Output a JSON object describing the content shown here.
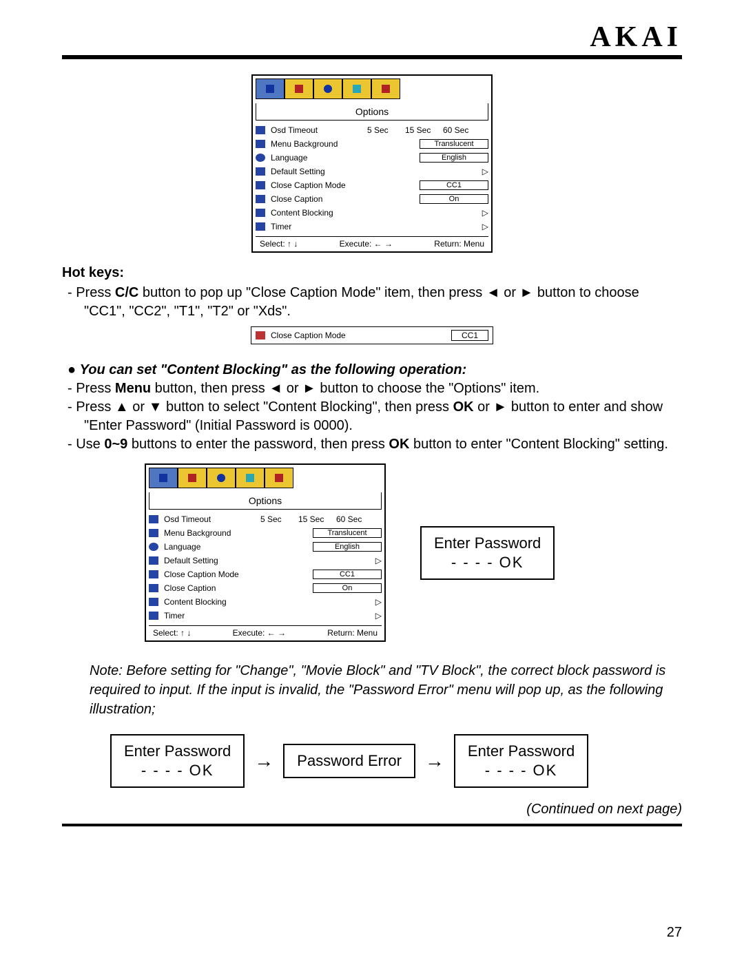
{
  "brand": "AKAI",
  "page_number": "27",
  "continued": "(Continued on next page)",
  "hotkeys_title": "Hot keys:",
  "hk_bullet_1_a": "Press ",
  "hk_bullet_1_b": "C/C",
  "hk_bullet_1_c": " button to pop up \"Close Caption Mode\" item, then press ◄ or ► button to choose \"CC1\", \"CC2\", \"T1\", \"T2\" or \"Xds\".",
  "cb_heading": "You can set \"Content Blocking\" as the following operation:",
  "cb_b1_a": "Press ",
  "cb_b1_b": "Menu",
  "cb_b1_c": " button, then press ◄ or ► button to choose the \"Options\" item.",
  "cb_b2_a": "Press ▲ or ▼ button to select \"Content Blocking\", then press ",
  "cb_b2_b": "OK",
  "cb_b2_c": " or ► button to enter and show \"Enter Password\" (Initial Password is 0000).",
  "cb_b3_a": "Use ",
  "cb_b3_b": "0~9",
  "cb_b3_c": " buttons to enter the password, then press ",
  "cb_b3_d": "OK",
  "cb_b3_e": " button to enter \"Content Blocking\" setting.",
  "note": "Note:  Before setting for \"Change\", \"Movie Block\" and \"TV Block\", the correct block password is required to input. If the input is invalid, the \"Password Error\" menu will pop up, as the following illustration;",
  "osd": {
    "title": "Options",
    "foot_select": "Select: ↑  ↓",
    "foot_execute": "Execute: ←  →",
    "foot_return": "Return:   Menu",
    "rows": {
      "osd_timeout": {
        "label": "Osd Timeout",
        "v1": "5 Sec",
        "v2": "15 Sec",
        "v3": "60 Sec"
      },
      "menu_bg": {
        "label": "Menu Background",
        "box": "Translucent"
      },
      "language": {
        "label": "Language",
        "box": "English"
      },
      "default": {
        "label": "Default Setting"
      },
      "ccm": {
        "label": "Close Caption Mode",
        "box": "CC1"
      },
      "cc": {
        "label": "Close Caption",
        "box": "On"
      },
      "cblock": {
        "label": "Content Blocking"
      },
      "timer": {
        "label": "Timer"
      }
    }
  },
  "ccm_single": {
    "label": "Close Caption Mode",
    "value": "CC1"
  },
  "enter_pw": {
    "line1": "Enter Password",
    "line2": "- - - -      OK"
  },
  "enter_pw2": {
    "line1": "Enter  Password",
    "line2": "- - - -          OK"
  },
  "pw_error": {
    "label": "Password    Error"
  },
  "arrows": {
    "right": "→"
  }
}
